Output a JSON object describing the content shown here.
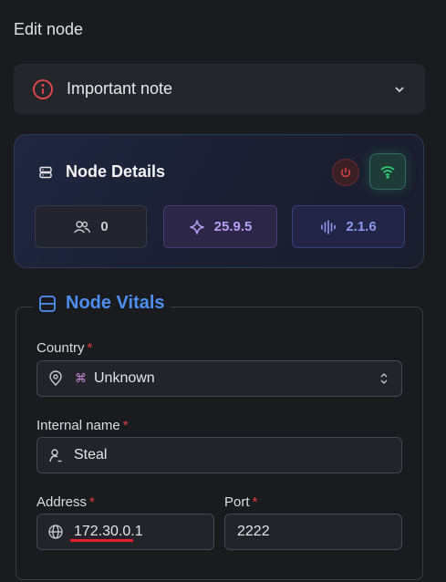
{
  "title": "Edit node",
  "note": {
    "label": "Important note",
    "icon": "info-circle-icon",
    "expand_icon": "chevron-down-icon"
  },
  "details": {
    "title": "Node Details",
    "icon": "server-icon",
    "power_icon": "power-icon",
    "connection_icon": "wifi-icon",
    "stats": [
      {
        "icon": "users-icon",
        "value": "0"
      },
      {
        "icon": "sparkle-icon",
        "value": "25.9.5"
      },
      {
        "icon": "audio-bars-icon",
        "value": "2.1.6"
      }
    ]
  },
  "vitals": {
    "title": "Node Vitals",
    "icon": "layout-icon",
    "country": {
      "label": "Country",
      "required": "*",
      "flag": "⌘",
      "value": "Unknown",
      "icon": "map-pin-icon"
    },
    "internal_name": {
      "label": "Internal name",
      "required": "*",
      "value": "Steal",
      "icon": "user-icon"
    },
    "address": {
      "label": "Address",
      "required": "*",
      "value": "172.30.0.1",
      "icon": "globe-icon"
    },
    "port": {
      "label": "Port",
      "required": "*",
      "value": "2222"
    }
  },
  "colors": {
    "accent": "#4d8ff0",
    "danger": "#e03e3e",
    "success": "#2ecc71",
    "core": "#b79df5",
    "xray": "#8f96f0"
  }
}
